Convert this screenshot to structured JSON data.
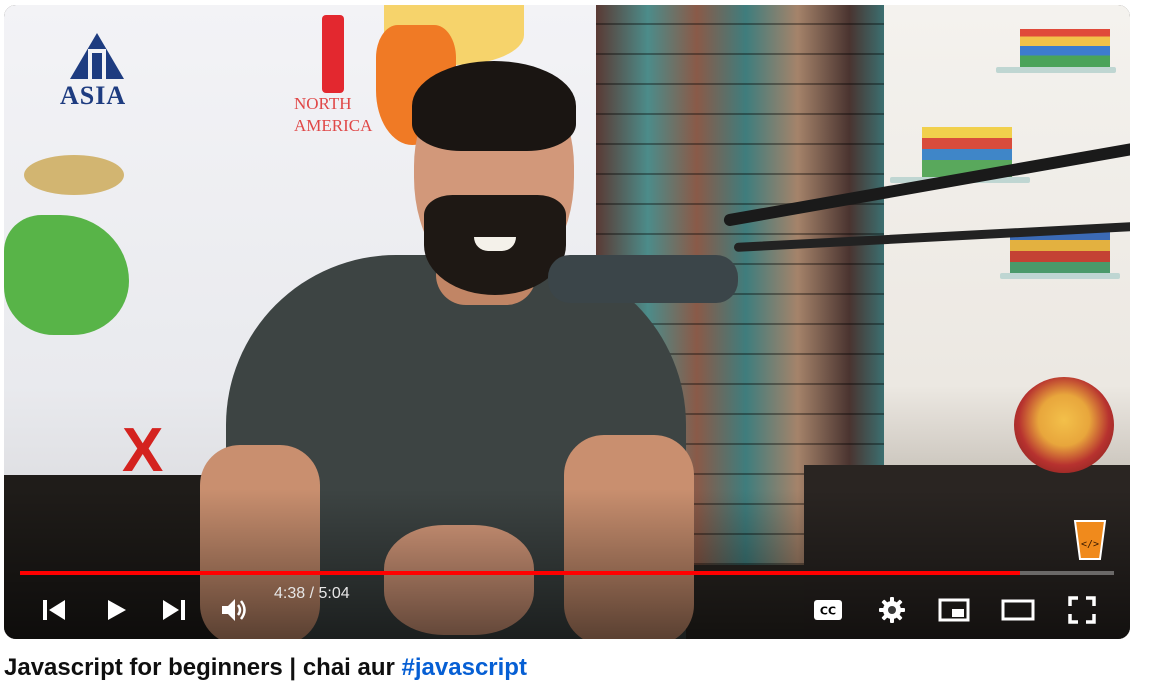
{
  "video": {
    "current_time": "4:38",
    "separator": " / ",
    "duration": "5:04",
    "progress_fraction": 0.9145,
    "scene_labels": {
      "asia": "ASIA",
      "north_america": "NORTH AMERICA"
    }
  },
  "controls": {
    "left": [
      "previous-icon",
      "play-icon",
      "next-icon",
      "volume-icon"
    ],
    "right": [
      "captions-icon",
      "settings-icon",
      "miniplayer-icon",
      "theater-mode-icon",
      "fullscreen-icon"
    ]
  },
  "title": {
    "text": "Javascript for beginners | chai aur ",
    "hashtag": "#javascript"
  },
  "colors": {
    "progress_played": "#ff0000",
    "hashtag_link": "#065fd4",
    "title_text": "#0f0f0f"
  }
}
